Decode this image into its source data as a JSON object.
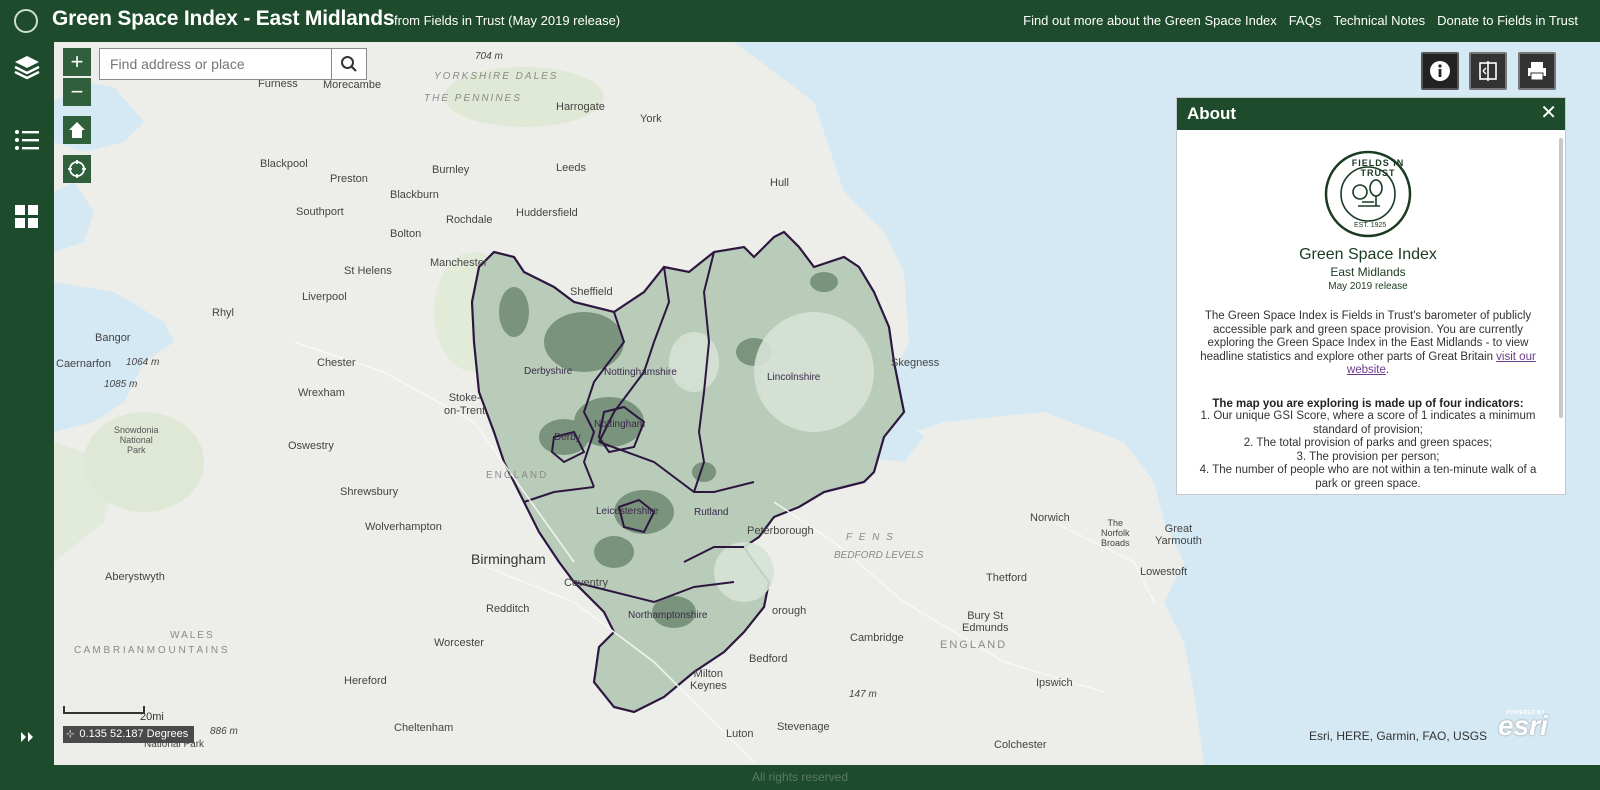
{
  "header": {
    "title": "Green Space Index - East Midlands",
    "subtitle": "from Fields in Trust (May 2019 release)",
    "links": [
      "Find out more about the Green Space Index",
      "FAQs",
      "Technical Notes",
      "Donate to Fields in Trust"
    ]
  },
  "sidebar": {
    "items": [
      "layers-icon",
      "legend-list-icon",
      "apps-grid-icon"
    ],
    "expand": "expand-icon"
  },
  "search": {
    "placeholder": "Find address or place"
  },
  "zoom": {
    "in": "+",
    "out": "−"
  },
  "about": {
    "title": "About",
    "close": "✕",
    "logo_text": "FIELDS IN TRUST",
    "logo_est": "EST. 1925",
    "index_title": "Green Space Index",
    "region": "East Midlands",
    "release": "May 2019 release",
    "description": "The Green Space Index is Fields in Trust's barometer of publicly accessible park and green space provision. You are currently exploring the Green Space Index in the East Midlands - to view headline statistics and explore other parts of Great Britain ",
    "link_text": "visit our website",
    "indicators_heading": "The map you are exploring is made up of four indicators:",
    "indicators": [
      "1. Our unique GSI Score, where a score of 1 indicates a minimum standard of provision;",
      "2. The total provision of parks and green spaces;",
      "3. The provision per person;",
      "4. The number of people who are not within a ten-minute walk of a park or green space."
    ]
  },
  "map": {
    "labels": {
      "furness": "Furness",
      "morecambe": "Morecambe",
      "yorkshire_dales": "YORKSHIRE DALES",
      "pennines": "THE PENNINES",
      "harrogate": "Harrogate",
      "york": "York",
      "blackpool": "Blackpool",
      "burnley": "Burnley",
      "preston": "Preston",
      "leeds": "Leeds",
      "hull": "Hull",
      "blackburn": "Blackburn",
      "southport": "Southport",
      "rochdale": "Rochdale",
      "huddersfield": "Huddersfield",
      "bolton": "Bolton",
      "st_helens": "St Helens",
      "manchester": "Manchester",
      "sheffield": "Sheffield",
      "liverpool": "Liverpool",
      "rhyl": "Rhyl",
      "bangor": "Bangor",
      "caernarfon": "Caernarfon",
      "chester": "Chester",
      "wrexham": "Wrexham",
      "stoke": "Stoke-\non-Trent",
      "oswestry": "Oswestry",
      "shrewsbury": "Shrewsbury",
      "wolverhampton": "Wolverhampton",
      "birmingham": "Birmingham",
      "aberystwyth": "Aberystwyth",
      "coventry": "Coventry",
      "redditch": "Redditch",
      "worcester": "Worcester",
      "hereford": "Hereford",
      "cheltenham": "Cheltenham",
      "peterborough": "Peterborough",
      "norwich": "Norwich",
      "great_yarmouth": "Great\nYarmouth",
      "lowestoft": "Lowestoft",
      "norfolk_broads": "The\nNorfolk\nBroads",
      "thetford": "Thetford",
      "bury": "Bury St\nEdmunds",
      "cambridge": "Cambridge",
      "bedford": "Bedford",
      "milton_keynes": "Milton\nKeynes",
      "ipswich": "Ipswich",
      "stevenage": "Stevenage",
      "luton": "Luton",
      "colchester": "Colchester",
      "skegness": "Skegness",
      "snowdonia": "Snowdonia\nNational\nPark",
      "fens": "F E N S",
      "bedford_levels": "BEDFORD LEVELS",
      "wales": "WALES",
      "cambrian": "C A M B R I A N   M O U N T A I N S",
      "england_w": "ENGLAND",
      "england_e": "ENGLAND",
      "e704": "704 m",
      "e1064": "1064 m",
      "e1085": "1085 m",
      "e147": "147 m",
      "e886": "886 m",
      "derbyshire": "Derbyshire",
      "nottinghamshire": "Nottinghamshire",
      "lincolnshire": "Lincolnshire",
      "nottingham": "Nottingham",
      "derby": "Derby",
      "leicestershire": "Leicestershire",
      "rutland": "Rutland",
      "northamptonshire": "Northamptonshire",
      "orough": "orough",
      "national_park": "National Park"
    },
    "scale": "20mi",
    "coords": "0.135 52.187 Degrees",
    "attribution": "Esri, HERE, Garmin, FAO, USGS",
    "esri": "esri",
    "powered_by": "POWERED BY"
  },
  "footer": {
    "text": "All rights reserved"
  },
  "colors": {
    "brand": "#1d4b2b",
    "boundary": "#2d1740",
    "fill_light": "#c5d5c6",
    "fill_dark": "#5d7a62"
  }
}
